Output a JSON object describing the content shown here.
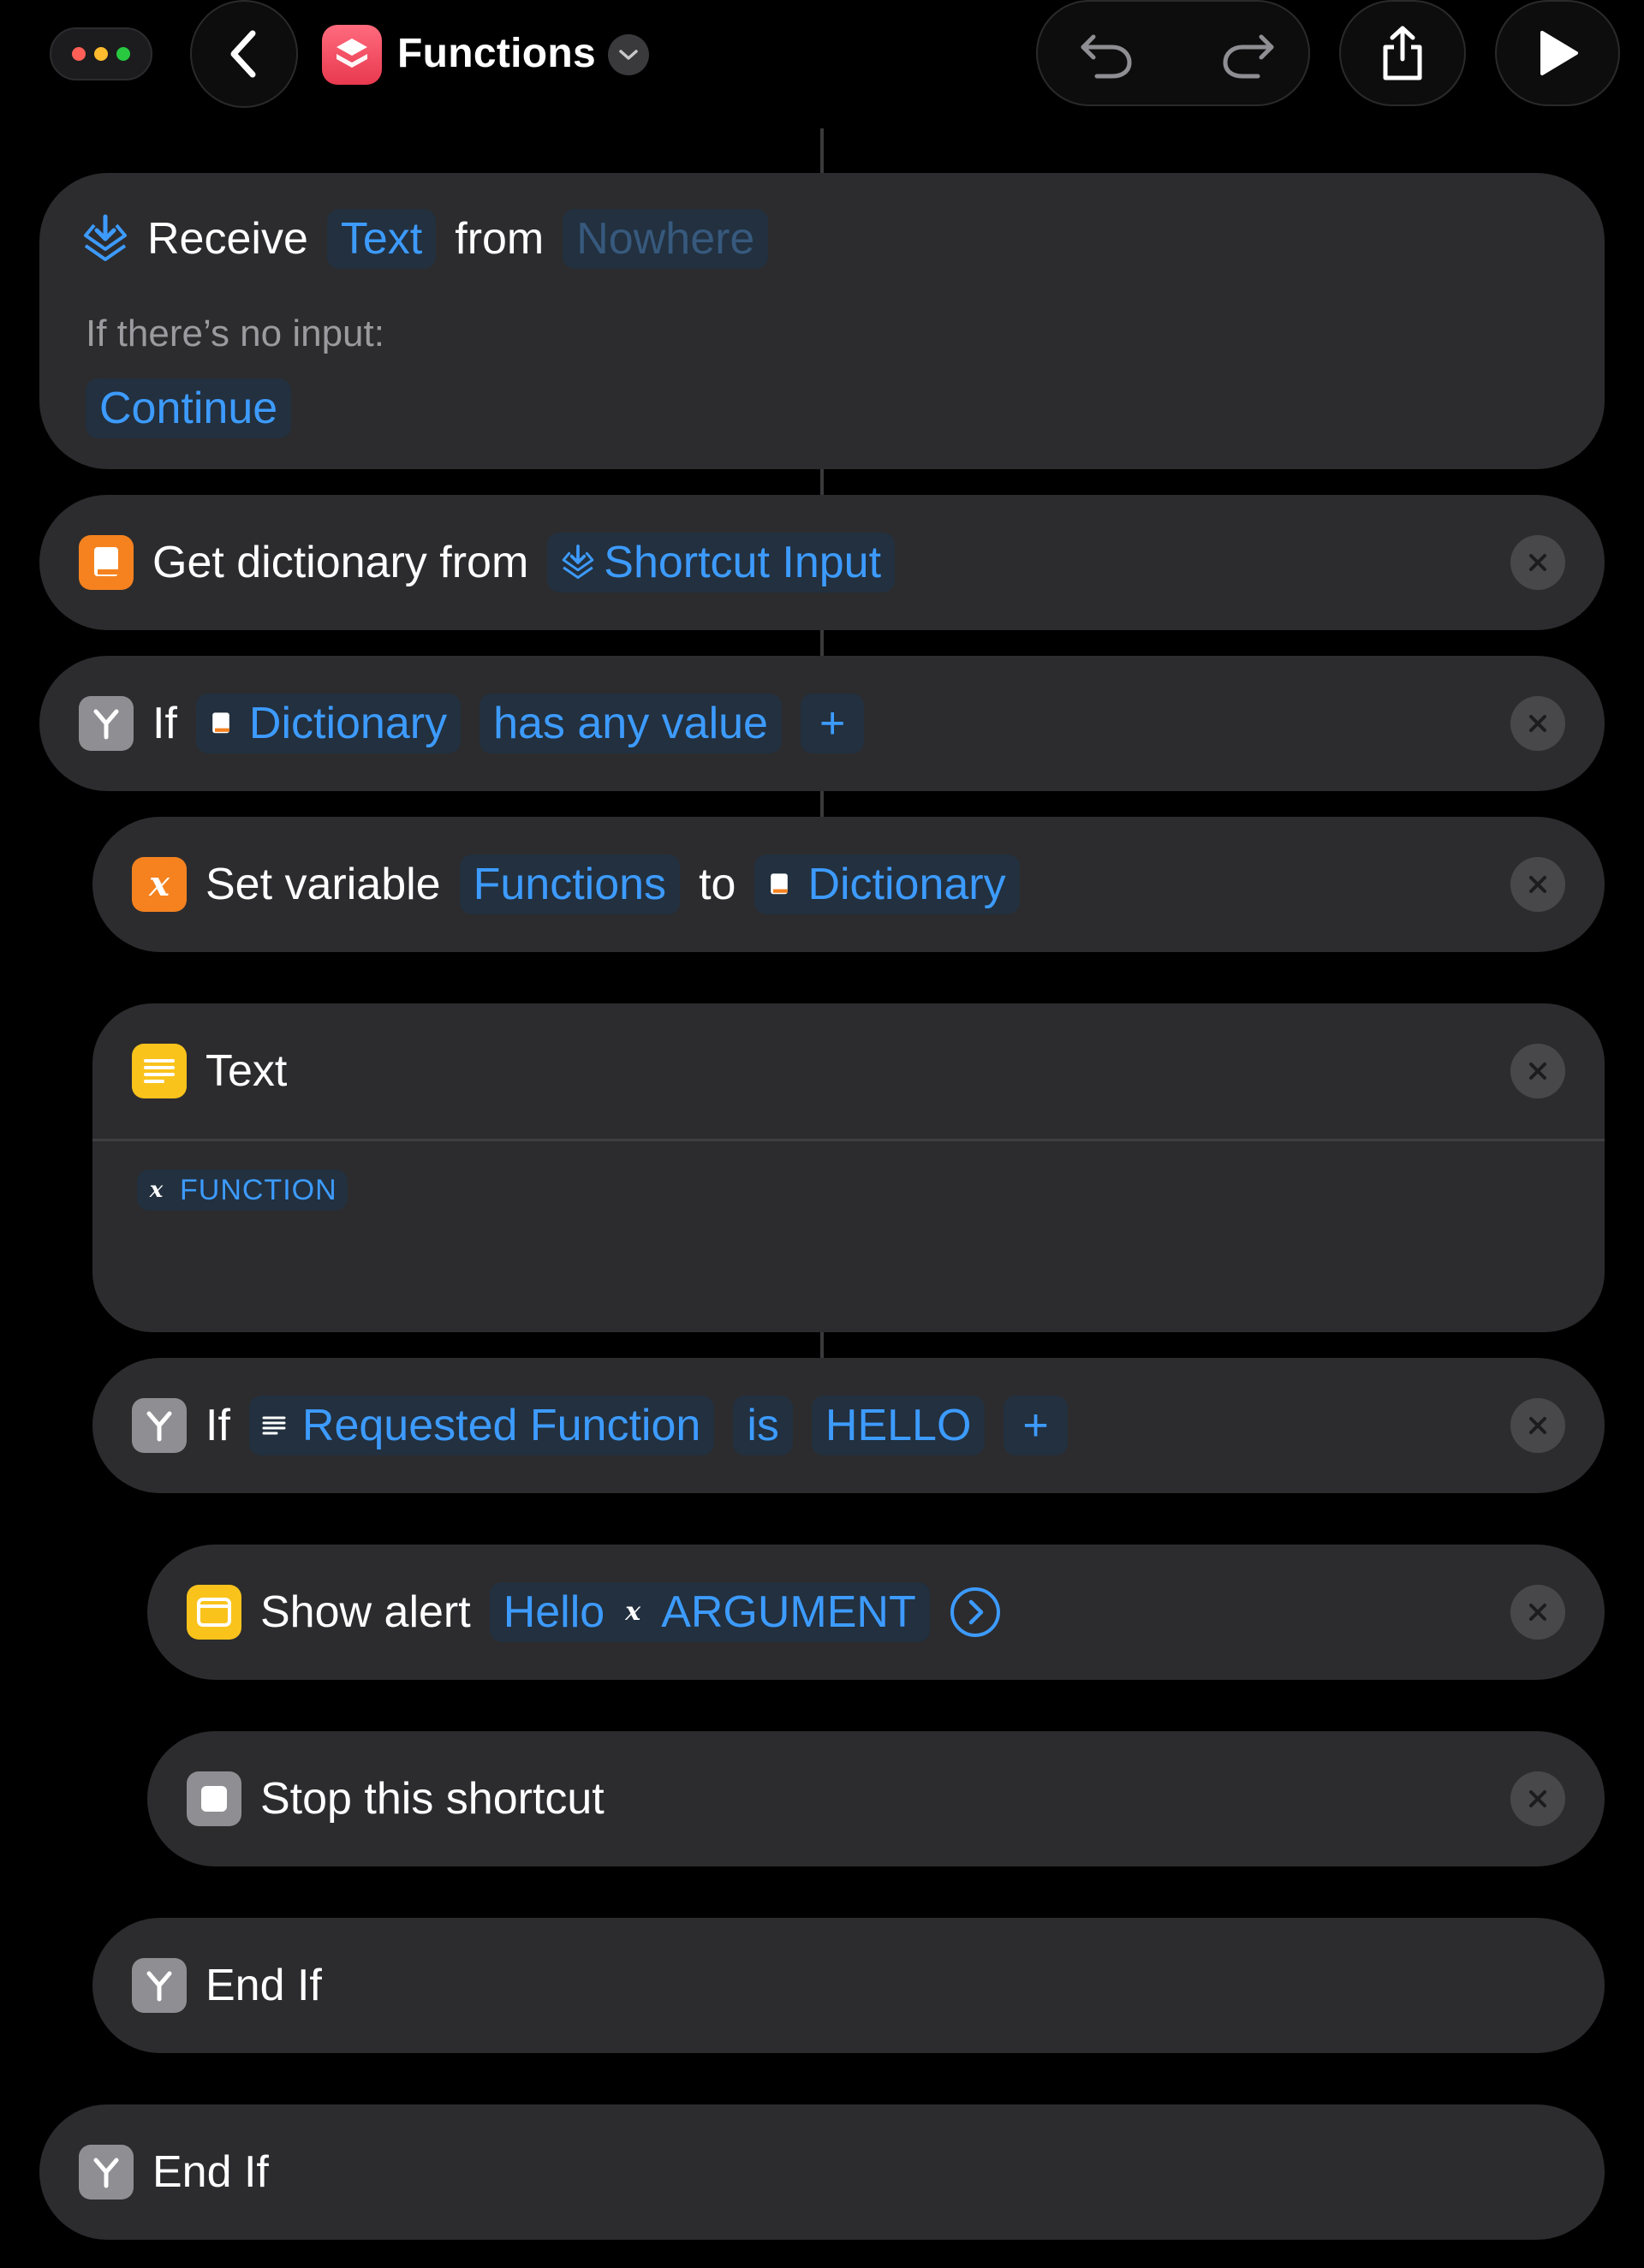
{
  "header": {
    "title": "Functions",
    "colors": {
      "dot_red": "#ff5f57",
      "dot_yellow": "#febc2e",
      "dot_green": "#28c840",
      "app_badge": "#ef4a5e"
    }
  },
  "actions": {
    "receive": {
      "verb": "Receive",
      "type": "Text",
      "from_word": "from",
      "source": "Nowhere",
      "no_input_label": "If there’s no input:",
      "no_input_action": "Continue"
    },
    "get_dictionary": {
      "label": "Get dictionary from",
      "input": "Shortcut Input"
    },
    "if_outer": {
      "keyword": "If",
      "variable": "Dictionary",
      "condition": "has any value",
      "add": "+"
    },
    "set_variable": {
      "label": "Set variable",
      "name": "Functions",
      "to_word": "to",
      "value": "Dictionary"
    },
    "text": {
      "title": "Text",
      "token": "FUNCTION"
    },
    "if_inner": {
      "keyword": "If",
      "variable": "Requested Function",
      "operator": "is",
      "value": "HELLO",
      "add": "+"
    },
    "show_alert": {
      "label": "Show alert",
      "message_prefix": "Hello",
      "message_var": "ARGUMENT"
    },
    "stop": {
      "label": "Stop this shortcut"
    },
    "end_if_inner": {
      "label": "End If"
    },
    "end_if_outer": {
      "label": "End If"
    }
  },
  "icons": {
    "receive": "shortcut-input-icon",
    "dictionary": "dictionary-icon",
    "if": "branch-icon",
    "variable": "variable-x-icon",
    "text": "text-lines-icon",
    "alert": "alert-window-icon",
    "stop": "stop-square-icon"
  }
}
